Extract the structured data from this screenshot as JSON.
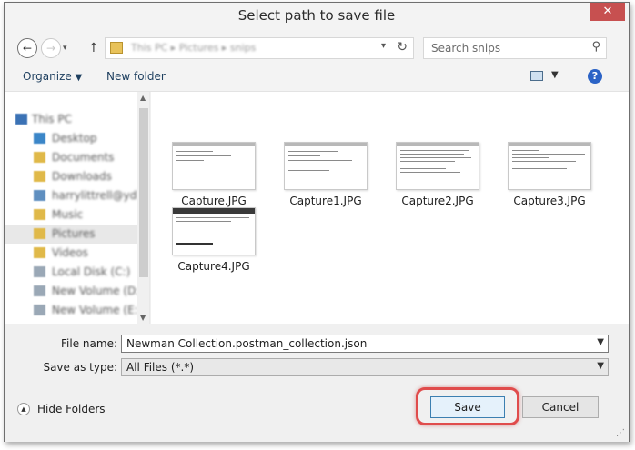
{
  "window": {
    "title": "Select path to save file",
    "close_glyph": "✕"
  },
  "address": {
    "breadcrumb": [
      "This PC",
      "Pictures",
      "snips"
    ],
    "search_placeholder": "Search snips"
  },
  "toolbar": {
    "organize_label": "Organize",
    "new_folder_label": "New folder"
  },
  "nav": {
    "items": [
      {
        "label": "This PC",
        "icon": "computer-icon"
      },
      {
        "label": "Desktop",
        "icon": "folder-icon"
      },
      {
        "label": "Documents",
        "icon": "folder-icon"
      },
      {
        "label": "Downloads",
        "icon": "folder-icon"
      },
      {
        "label": "harrylittrell@ydl",
        "icon": "user-folder-icon"
      },
      {
        "label": "Music",
        "icon": "folder-icon"
      },
      {
        "label": "Pictures",
        "icon": "folder-icon",
        "selected": true
      },
      {
        "label": "Videos",
        "icon": "folder-icon"
      },
      {
        "label": "Local Disk (C:)",
        "icon": "drive-icon"
      },
      {
        "label": "New Volume (D:)",
        "icon": "drive-icon"
      },
      {
        "label": "New Volume (E:)",
        "icon": "drive-icon"
      }
    ]
  },
  "files": [
    {
      "name": "Capture.JPG"
    },
    {
      "name": "Capture1.JPG"
    },
    {
      "name": "Capture2.JPG"
    },
    {
      "name": "Capture3.JPG"
    },
    {
      "name": "Capture4.JPG"
    }
  ],
  "form": {
    "file_name_label": "File name:",
    "file_name_value": "Newman Collection.postman_collection.json",
    "save_as_label": "Save as type:",
    "save_as_value": "All Files (*.*)"
  },
  "footer": {
    "hide_folders_label": "Hide Folders",
    "save_label": "Save",
    "cancel_label": "Cancel"
  },
  "colors": {
    "highlight_ring": "#e04c4c",
    "close_button": "#c75050",
    "link_text": "#1e3f5f"
  }
}
